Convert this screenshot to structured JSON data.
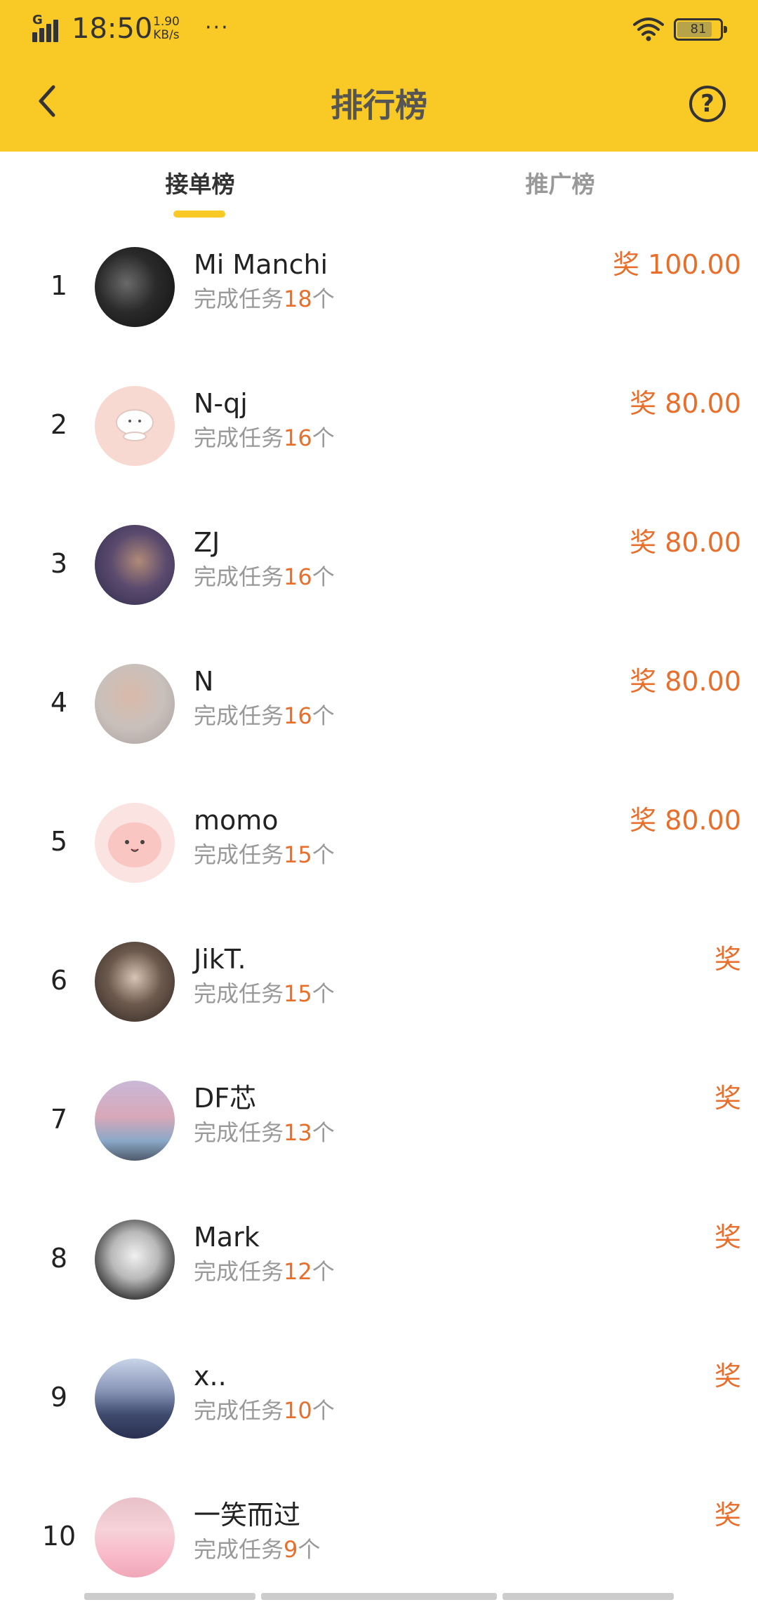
{
  "status_bar": {
    "network": "G",
    "time": "18:50",
    "speed_value": "1.90",
    "speed_unit": "KB/s",
    "more": "···",
    "battery": "81"
  },
  "nav": {
    "title": "排行榜",
    "help": "?"
  },
  "tabs": [
    {
      "label": "接单榜",
      "active": true
    },
    {
      "label": "推广榜",
      "active": false
    }
  ],
  "rows": [
    {
      "rank": "1",
      "name": "Mi Manchi",
      "tasks_prefix": "完成任务",
      "tasks_count": "18",
      "tasks_suffix": "个",
      "reward": "奖 100.00"
    },
    {
      "rank": "2",
      "name": "N-qj",
      "tasks_prefix": "完成任务",
      "tasks_count": "16",
      "tasks_suffix": "个",
      "reward": "奖 80.00"
    },
    {
      "rank": "3",
      "name": "ZJ",
      "tasks_prefix": "完成任务",
      "tasks_count": "16",
      "tasks_suffix": "个",
      "reward": "奖 80.00"
    },
    {
      "rank": "4",
      "name": "N",
      "tasks_prefix": "完成任务",
      "tasks_count": "16",
      "tasks_suffix": "个",
      "reward": "奖 80.00"
    },
    {
      "rank": "5",
      "name": "momo",
      "tasks_prefix": "完成任务",
      "tasks_count": "15",
      "tasks_suffix": "个",
      "reward": "奖 80.00"
    },
    {
      "rank": "6",
      "name": "JikT.",
      "tasks_prefix": "完成任务",
      "tasks_count": "15",
      "tasks_suffix": "个",
      "reward": "奖"
    },
    {
      "rank": "7",
      "name": "DF芯",
      "tasks_prefix": "完成任务",
      "tasks_count": "13",
      "tasks_suffix": "个",
      "reward": "奖"
    },
    {
      "rank": "8",
      "name": "Mark",
      "tasks_prefix": "完成任务",
      "tasks_count": "12",
      "tasks_suffix": "个",
      "reward": "奖"
    },
    {
      "rank": "9",
      "name": "x..",
      "tasks_prefix": "完成任务",
      "tasks_count": "10",
      "tasks_suffix": "个",
      "reward": "奖"
    },
    {
      "rank": "10",
      "name": "一笑而过",
      "tasks_prefix": "完成任务",
      "tasks_count": "9",
      "tasks_suffix": "个",
      "reward": "奖"
    }
  ],
  "colors": {
    "header": "#F9C926",
    "accent": "#E86E2B",
    "muted": "#999999"
  }
}
